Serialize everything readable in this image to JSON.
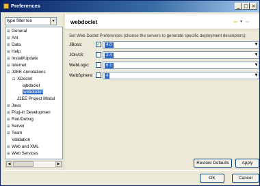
{
  "window": {
    "title": "Preferences",
    "min_glyph": "_",
    "max_glyph": "□",
    "close_glyph": "×"
  },
  "sidebar": {
    "filter_placeholder": "type filter tex",
    "filter_arrow": "▼",
    "items": [
      {
        "label": "General",
        "exp": "⊞"
      },
      {
        "label": "Ant",
        "exp": "⊞"
      },
      {
        "label": "Data",
        "exp": "⊞"
      },
      {
        "label": "Help",
        "exp": "⊞"
      },
      {
        "label": "Install/Update",
        "exp": "⊞"
      },
      {
        "label": "Internet",
        "exp": "⊞"
      },
      {
        "label": "J2EE Annotations",
        "exp": "⊟"
      },
      {
        "label": "XDoclet",
        "exp": "⊟"
      },
      {
        "label": "ejbdoclet",
        "exp": ""
      },
      {
        "label": "webdoclet",
        "exp": ""
      },
      {
        "label": "J2EE Project Modul",
        "exp": ""
      },
      {
        "label": "Java",
        "exp": "⊞"
      },
      {
        "label": "Plug-in Developmen",
        "exp": "⊞"
      },
      {
        "label": "Run/Debug",
        "exp": "⊞"
      },
      {
        "label": "Server",
        "exp": "⊞"
      },
      {
        "label": "Team",
        "exp": "⊞"
      },
      {
        "label": "Validation",
        "exp": ""
      },
      {
        "label": "Web and XML",
        "exp": "⊞"
      },
      {
        "label": "Web Services",
        "exp": "⊞"
      }
    ],
    "scroll_left": "◀",
    "scroll_right": "▶"
  },
  "page": {
    "title": "webdoclet",
    "nav_back": "⇦",
    "nav_menu": "▾",
    "nav_fwd": "⇨",
    "description": "Set Web Doclet Preferences (choose the servers to generate specific deployment descriptors):",
    "servers": [
      {
        "label": "JBoss:",
        "checked": "✓",
        "version": "4.0",
        "arrow": "▼"
      },
      {
        "label": "JOnAS:",
        "checked": "",
        "version": "2.4",
        "arrow": "▼"
      },
      {
        "label": "WebLogic:",
        "checked": "",
        "version": "6.1",
        "arrow": "▼"
      },
      {
        "label": "WebSphere:",
        "checked": "",
        "version": "4",
        "arrow": "▼"
      }
    ]
  },
  "buttons": {
    "restore_defaults": "Restore Defaults",
    "apply": "Apply",
    "ok": "OK",
    "cancel": "Cancel"
  }
}
